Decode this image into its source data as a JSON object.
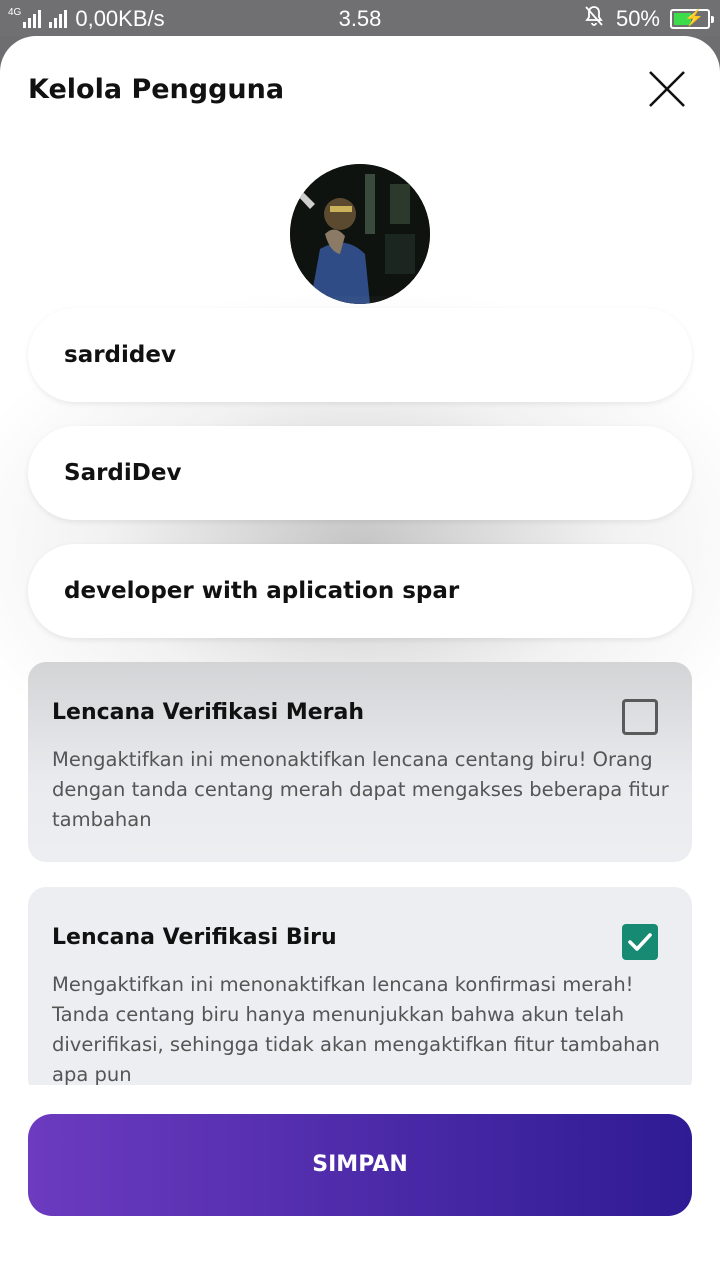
{
  "status_bar": {
    "network": "4G",
    "speed": "0,00KB/s",
    "time": "3.58",
    "battery_percent": "50%"
  },
  "sheet": {
    "title": "Kelola Pengguna",
    "close_icon": "close-icon"
  },
  "form": {
    "username": "sardidev",
    "display_name": "SardiDev",
    "bio": "developer with aplication spar"
  },
  "badges": [
    {
      "title": "Lencana Verifikasi Merah",
      "description": "Mengaktifkan ini menonaktifkan lencana centang biru! Orang dengan tanda centang merah dapat mengakses beberapa fitur tambahan",
      "checked": false
    },
    {
      "title": "Lencana Verifikasi Biru",
      "description": "Mengaktifkan ini menonaktifkan lencana konfirmasi merah! Tanda centang biru hanya menunjukkan bahwa akun telah diverifikasi, sehingga tidak akan mengaktifkan fitur tambahan apa pun",
      "checked": true
    }
  ],
  "actions": {
    "save_label": "SIMPAN"
  },
  "colors": {
    "accent_start": "#6c3bbf",
    "accent_end": "#2f1b94",
    "checkbox_checked": "#168a73"
  }
}
